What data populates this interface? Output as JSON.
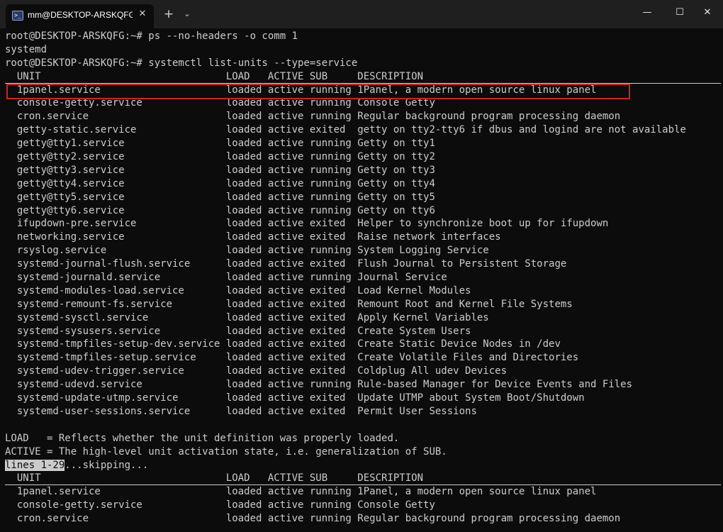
{
  "window": {
    "tab_title": "mm@DESKTOP-ARSKQFG: /m",
    "tab_icon": "powershell-icon",
    "close_tab_glyph": "✕",
    "new_tab_glyph": "+",
    "dropdown_glyph": "⌄",
    "minimize_glyph": "—",
    "maximize_glyph": "☐",
    "close_glyph": "✕"
  },
  "terminal": {
    "lines": [
      "root@DESKTOP-ARSKQFG:~# ps --no-headers -o comm 1",
      "systemd",
      "root@DESKTOP-ARSKQFG:~# systemctl list-units --type=service",
      "  UNIT                               LOAD   ACTIVE SUB     DESCRIPTION",
      "  1panel.service                     loaded active running 1Panel, a modern open source linux panel",
      "  console-getty.service              loaded active running Console Getty",
      "  cron.service                       loaded active running Regular background program processing daemon",
      "  getty-static.service               loaded active exited  getty on tty2-tty6 if dbus and logind are not available",
      "  getty@tty1.service                 loaded active running Getty on tty1",
      "  getty@tty2.service                 loaded active running Getty on tty2",
      "  getty@tty3.service                 loaded active running Getty on tty3",
      "  getty@tty4.service                 loaded active running Getty on tty4",
      "  getty@tty5.service                 loaded active running Getty on tty5",
      "  getty@tty6.service                 loaded active running Getty on tty6",
      "  ifupdown-pre.service               loaded active exited  Helper to synchronize boot up for ifupdown",
      "  networking.service                 loaded active exited  Raise network interfaces",
      "  rsyslog.service                    loaded active running System Logging Service",
      "  systemd-journal-flush.service      loaded active exited  Flush Journal to Persistent Storage",
      "  systemd-journald.service           loaded active running Journal Service",
      "  systemd-modules-load.service       loaded active exited  Load Kernel Modules",
      "  systemd-remount-fs.service         loaded active exited  Remount Root and Kernel File Systems",
      "  systemd-sysctl.service             loaded active exited  Apply Kernel Variables",
      "  systemd-sysusers.service           loaded active exited  Create System Users",
      "  systemd-tmpfiles-setup-dev.service loaded active exited  Create Static Device Nodes in /dev",
      "  systemd-tmpfiles-setup.service     loaded active exited  Create Volatile Files and Directories",
      "  systemd-udev-trigger.service       loaded active exited  Coldplug All udev Devices",
      "  systemd-udevd.service              loaded active running Rule-based Manager for Device Events and Files",
      "  systemd-update-utmp.service        loaded active exited  Update UTMP about System Boot/Shutdown",
      "  systemd-user-sessions.service      loaded active exited  Permit User Sessions",
      "",
      "LOAD   = Reflects whether the unit definition was properly loaded.",
      "ACTIVE = The high-level unit activation state, i.e. generalization of SUB.",
      "",
      "  UNIT                               LOAD   ACTIVE SUB     DESCRIPTION",
      "  1panel.service                     loaded active running 1Panel, a modern open source linux panel",
      "  console-getty.service              loaded active running Console Getty",
      "  cron.service                       loaded active running Regular background program processing daemon"
    ],
    "pager_highlight": "lines 1-29",
    "pager_rest": "...skipping..."
  },
  "colors": {
    "background": "#0c0c0c",
    "text": "#cccccc",
    "annotation": "#d32121"
  }
}
